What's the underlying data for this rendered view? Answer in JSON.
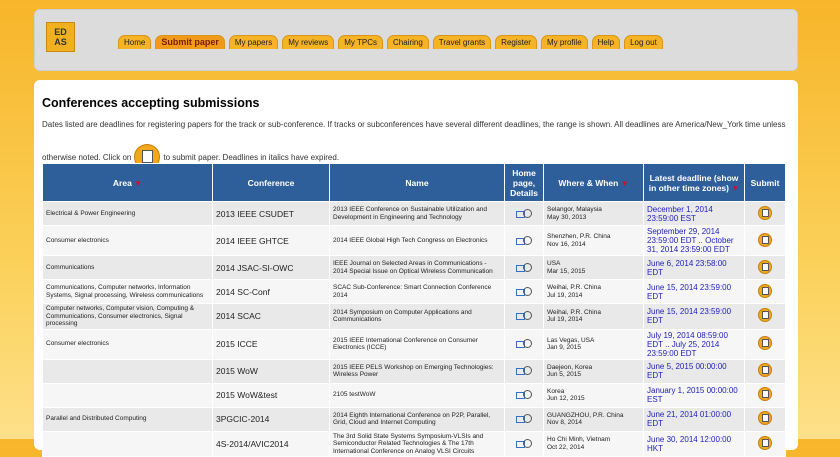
{
  "logo": {
    "line1": "ED",
    "line2": "AS"
  },
  "nav": [
    "Home",
    "Submit paper",
    "My papers",
    "My reviews",
    "My TPCs",
    "Chairing",
    "Travel grants",
    "Register",
    "My profile",
    "Help",
    "Log out"
  ],
  "page": {
    "title": "Conferences accepting submissions",
    "intro": "Dates listed are deadlines for registering papers for the track or sub-conference. If tracks or subconferences have several different deadlines, the range is shown. All deadlines are America/New_York time unless",
    "intro2a": "otherwise noted. Click on",
    "intro2b": "to submit paper. Deadlines in italics have expired."
  },
  "table": {
    "headers": {
      "area": "Area",
      "conference": "Conference",
      "name": "Name",
      "home": "Home page, Details",
      "where": "Where & When",
      "deadline": "Latest deadline (show in other time zones)",
      "submit": "Submit"
    },
    "rows": [
      {
        "area": "Electrical & Power Engineering",
        "conf": "2013 IEEE CSUDET",
        "name": "2013 IEEE Conference on Sustainable Utilization and Development in Engineering and Technology",
        "where": "Selangor, Malaysia",
        "when": "May 30, 2013",
        "deadline": "December 1, 2014 23:59:00 EST"
      },
      {
        "area": "Consumer electronics",
        "conf": "2014 IEEE GHTCE",
        "name": "2014 IEEE Global High Tech Congress on Electronics",
        "where": "Shenzhen, P.R. China",
        "when": "Nov 16, 2014",
        "deadline": "September 29, 2014 23:59:00 EDT .. October 31, 2014 23:59:00 EDT"
      },
      {
        "area": "Communications",
        "conf": "2014 JSAC-SI-OWC",
        "name": "IEEE Journal on Selected Areas in Communications - 2014 Special Issue on Optical Wireless Communication",
        "where": "USA",
        "when": "Mar 15, 2015",
        "deadline": "June 6, 2014 23:58:00 EDT"
      },
      {
        "area": "Communications, Computer networks, Information Systems, Signal processing, Wireless communications",
        "conf": "2014 SC-Conf",
        "name": "SCAC Sub-Conference: Smart Connection Conference 2014",
        "where": "Weihai, P.R. China",
        "when": "Jul 19, 2014",
        "deadline": "June 15, 2014 23:59:00 EDT"
      },
      {
        "area": "Computer networks, Computer vision, Computing & Communications, Consumer electronics, Signal processing",
        "conf": "2014 SCAC",
        "name": "2014 Symposium on Computer Applications and Communications",
        "where": "Weihai, P.R. China",
        "when": "Jul 19, 2014",
        "deadline": "June 15, 2014 23:59:00 EDT"
      },
      {
        "area": "Consumer electronics",
        "conf": "2015 ICCE",
        "name": "2015 IEEE International Conference on Consumer Electronics (ICCE)",
        "where": "Las Vegas, USA",
        "when": "Jan 9, 2015",
        "deadline": "July 19, 2014 08:59:00 EDT .. July 25, 2014 23:59:00 EDT"
      },
      {
        "area": "",
        "conf": "2015 WoW",
        "name": "2015 IEEE PELS Workshop on Emerging Technologies: Wireless Power",
        "where": "Daejeon, Korea",
        "when": "Jun 5, 2015",
        "deadline": "June 5, 2015 00:00:00 EDT"
      },
      {
        "area": "",
        "conf": "2015 WoW&test",
        "name": "2105 testWoW",
        "where": "Korea",
        "when": "Jun 12, 2015",
        "deadline": "January 1, 2015 00:00:00 EST"
      },
      {
        "area": "Parallel and Distributed Computing",
        "conf": "3PGCIC-2014",
        "name": "2014 Eighth International Conference on P2P, Parallel, Grid, Cloud and Internet Computing",
        "where": "GUANGZHOU, P.R. China",
        "when": "Nov 8, 2014",
        "deadline": "June 21, 2014 01:00:00 EDT"
      },
      {
        "area": "",
        "conf": "4S-2014/AVIC2014",
        "name": "The 3rd Solid State Systems Symposium-VLSIs and Semiconductor Related Technologies & The 17th International Conference on Analog VLSI Circuits",
        "where": "Ho Chi Minh, Vietnam",
        "when": "Oct 22, 2014",
        "deadline": "June 30, 2014 12:00:00 HKT"
      }
    ]
  }
}
